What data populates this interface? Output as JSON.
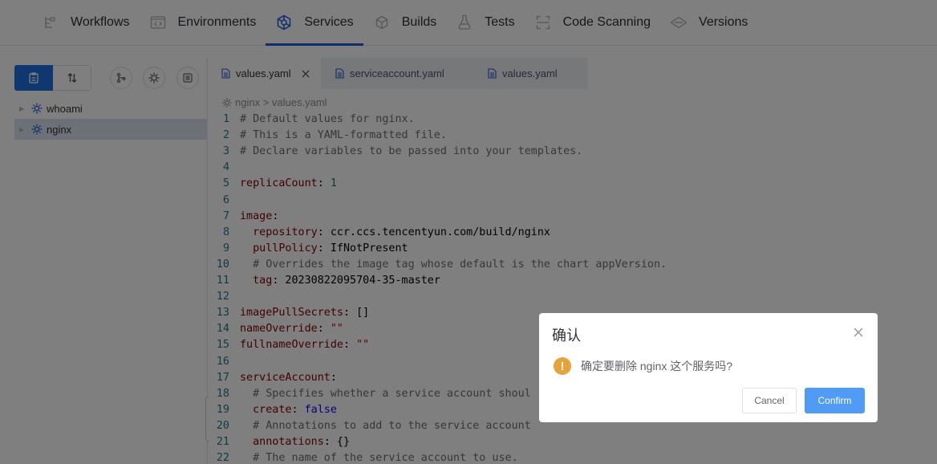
{
  "nav": {
    "items": [
      {
        "label": "Workflows",
        "icon": "workflow-icon"
      },
      {
        "label": "Environments",
        "icon": "environment-icon"
      },
      {
        "label": "Services",
        "icon": "service-icon",
        "active": true
      },
      {
        "label": "Builds",
        "icon": "build-icon"
      },
      {
        "label": "Tests",
        "icon": "test-flask-icon"
      },
      {
        "label": "Code Scanning",
        "icon": "scan-icon"
      },
      {
        "label": "Versions",
        "icon": "version-icon"
      }
    ],
    "accent": "#1f5bd6"
  },
  "sidebar": {
    "tree": [
      {
        "label": "whoami",
        "icon": "service-gear-icon"
      },
      {
        "label": "nginx",
        "icon": "service-gear-icon",
        "selected": true
      }
    ]
  },
  "editor": {
    "tabs": [
      {
        "label": "values.yaml",
        "active": true
      },
      {
        "label": "serviceaccount.yaml"
      },
      {
        "label": "values.yaml"
      }
    ],
    "breadcrumb": "nginx > values.yaml",
    "lines": [
      {
        "n": "1",
        "text": "# Default values for nginx."
      },
      {
        "n": "2",
        "text": "# This is a YAML-formatted file."
      },
      {
        "n": "3",
        "text": "# Declare variables to be passed into your templates."
      },
      {
        "n": "4",
        "text": ""
      },
      {
        "n": "5",
        "text": "replicaCount: 1"
      },
      {
        "n": "6",
        "text": ""
      },
      {
        "n": "7",
        "text": "image:"
      },
      {
        "n": "8",
        "text": "  repository: ccr.ccs.tencentyun.com/build/nginx"
      },
      {
        "n": "9",
        "text": "  pullPolicy: IfNotPresent"
      },
      {
        "n": "10",
        "text": "  # Overrides the image tag whose default is the chart appVersion."
      },
      {
        "n": "11",
        "text": "  tag: 20230822095704-35-master"
      },
      {
        "n": "12",
        "text": ""
      },
      {
        "n": "13",
        "text": "imagePullSecrets: []"
      },
      {
        "n": "14",
        "text": "nameOverride: \"\""
      },
      {
        "n": "15",
        "text": "fullnameOverride: \"\""
      },
      {
        "n": "16",
        "text": ""
      },
      {
        "n": "17",
        "text": "serviceAccount:"
      },
      {
        "n": "18",
        "text": "  # Specifies whether a service account shoul"
      },
      {
        "n": "19",
        "text": "  create: false"
      },
      {
        "n": "20",
        "text": "  # Annotations to add to the service account"
      },
      {
        "n": "21",
        "text": "  annotations: {}"
      },
      {
        "n": "22",
        "text": "  # The name of the service account to use."
      }
    ]
  },
  "dialog": {
    "title": "确认",
    "message": "确定要删除 nginx 这个服务吗?",
    "cancel_label": "Cancel",
    "confirm_label": "Confirm",
    "warning_color": "#e6a23c",
    "confirm_color": "#4f9bf5"
  }
}
